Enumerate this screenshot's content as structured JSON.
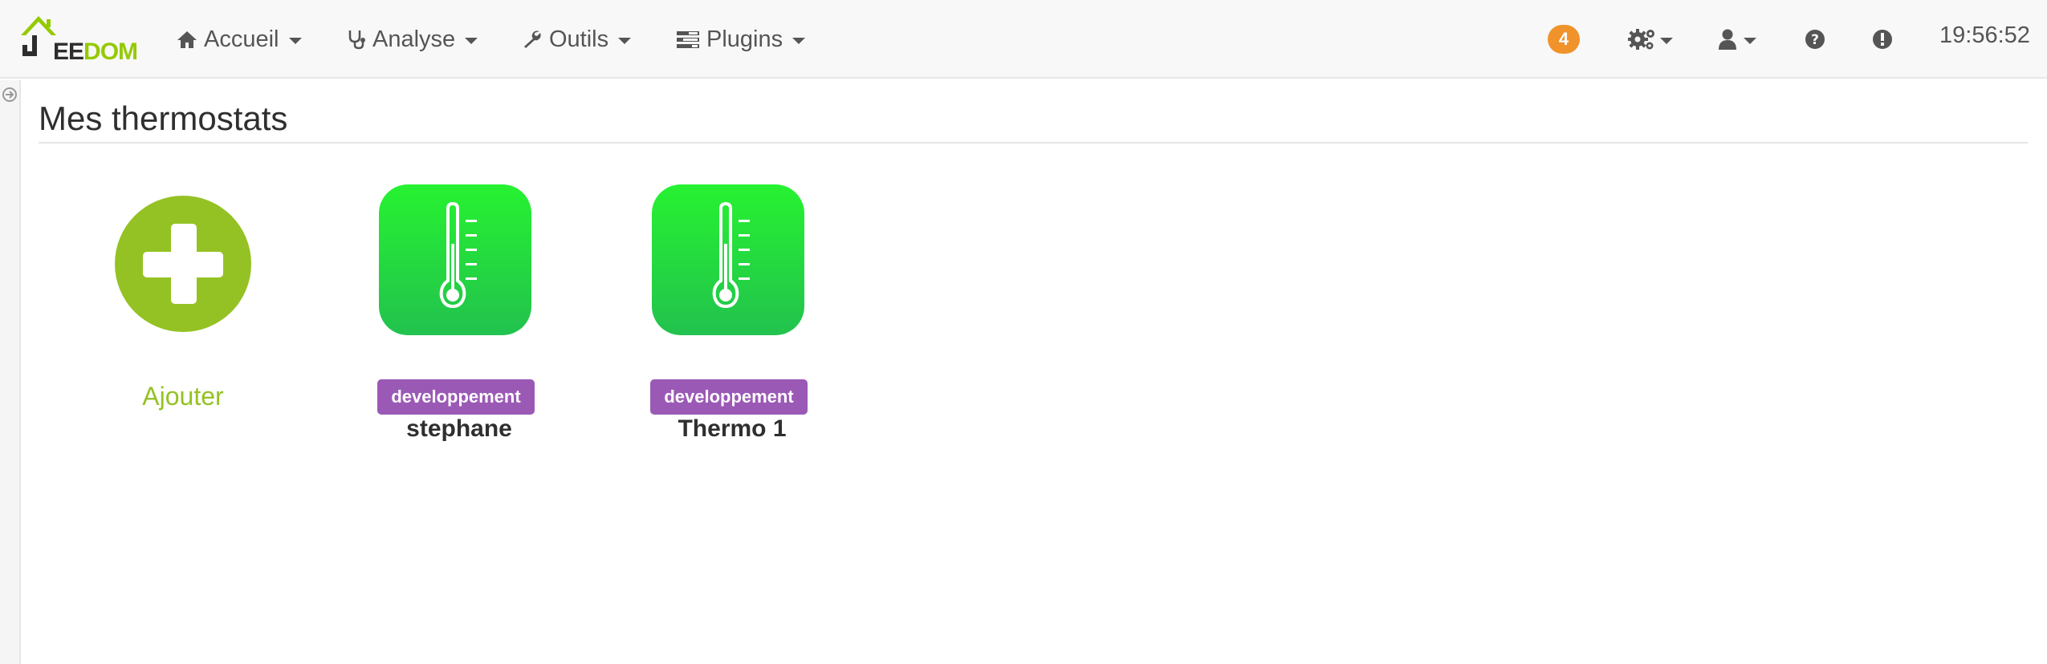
{
  "brand": {
    "logo_prefix": "EE",
    "logo_suffix": "DOM"
  },
  "nav": [
    {
      "label": "Accueil",
      "icon": "home-icon"
    },
    {
      "label": "Analyse",
      "icon": "stethoscope-icon"
    },
    {
      "label": "Outils",
      "icon": "wrench-icon"
    },
    {
      "label": "Plugins",
      "icon": "tasks-icon"
    }
  ],
  "header": {
    "notification_count": "4",
    "time": "19:56:52"
  },
  "page": {
    "title": "Mes thermostats"
  },
  "add_card": {
    "label": "Ajouter"
  },
  "equipments": [
    {
      "tag": "developpement",
      "name": "stephane"
    },
    {
      "tag": "developpement",
      "name": "Thermo 1"
    }
  ],
  "colors": {
    "accent_green": "#94c224",
    "tag_purple": "#9b59b6",
    "badge_orange": "#f0932b",
    "tile_green_top": "#27f231",
    "tile_green_bottom": "#22c24e"
  }
}
